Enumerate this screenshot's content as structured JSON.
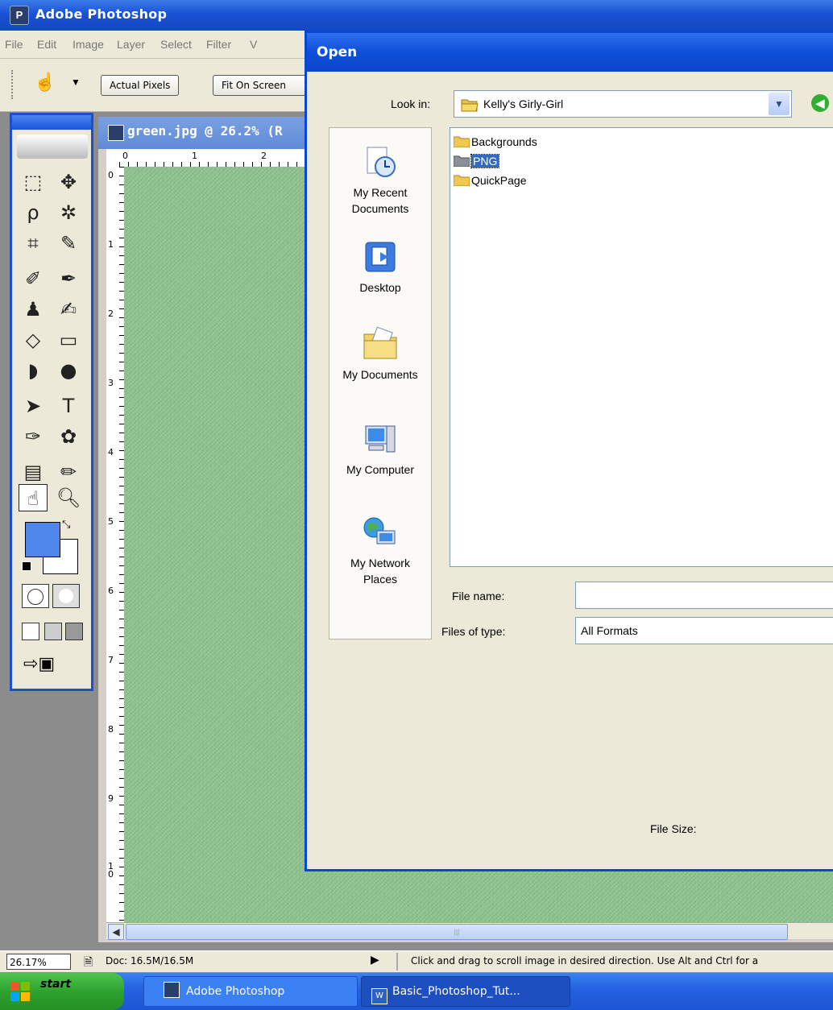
{
  "app": {
    "title": "Adobe Photoshop"
  },
  "menu": [
    "File",
    "Edit",
    "Image",
    "Layer",
    "Select",
    "Filter",
    "V"
  ],
  "options_bar": {
    "actual_pixels": "Actual Pixels",
    "fit_on_screen": "Fit On Screen"
  },
  "document": {
    "title": "green.jpg @ 26.2% (R",
    "ruler_top": [
      "0",
      "1",
      "2"
    ],
    "ruler_left": [
      "0",
      "1",
      "2",
      "3",
      "4",
      "5",
      "6",
      "7",
      "8",
      "9",
      "10"
    ]
  },
  "colors": {
    "foreground": "#4f86ec",
    "background": "#ffffff",
    "canvas": "#8cc08c"
  },
  "status": {
    "zoom": "26.17%",
    "doc": "Doc: 16.5M/16.5M",
    "message": "Click and drag to scroll image in desired direction. Use Alt and Ctrl for a"
  },
  "taskbar": {
    "start": "start",
    "items": [
      "Adobe Photoshop",
      "Basic_Photoshop_Tut..."
    ]
  },
  "dialog": {
    "title": "Open",
    "look_in_label": "Look in:",
    "look_in_value": "Kelly's Girly-Girl",
    "places": [
      "My Recent Documents",
      "Desktop",
      "My Documents",
      "My Computer",
      "My Network Places"
    ],
    "files": [
      {
        "name": "Backgrounds",
        "selected": false
      },
      {
        "name": "PNG",
        "selected": true
      },
      {
        "name": "QuickPage",
        "selected": false
      }
    ],
    "file_name_label": "File name:",
    "file_name_value": "",
    "files_of_type_label": "Files of type:",
    "files_of_type_value": "All Formats",
    "file_size_label": "File Size:"
  }
}
